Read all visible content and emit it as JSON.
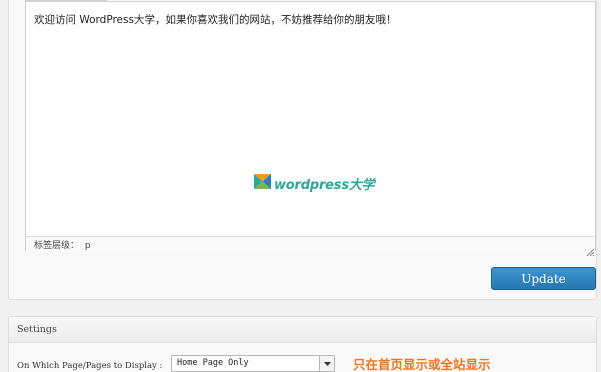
{
  "editor": {
    "content_text": "欢迎访问 WordPress大学，如果你喜欢我们的网站，不妨推荐给你的朋友哦！",
    "path_label": "标签层级：",
    "path_value": "p",
    "watermark_text": "wordpress大学"
  },
  "actions": {
    "update_label": "Update"
  },
  "settings": {
    "title": "Settings",
    "display_label": "On Which Page/Pages to Display :",
    "display_value": "Home Page Only",
    "annotation": "只在首页显示或全站显示"
  },
  "colors": {
    "accent": "#2677b1",
    "annotation": "#f0761e",
    "watermark": "#2aa89a"
  },
  "icons": [
    "wordpress-daxue-logo-icon",
    "resize-grip-icon",
    "chevron-down-icon"
  ]
}
